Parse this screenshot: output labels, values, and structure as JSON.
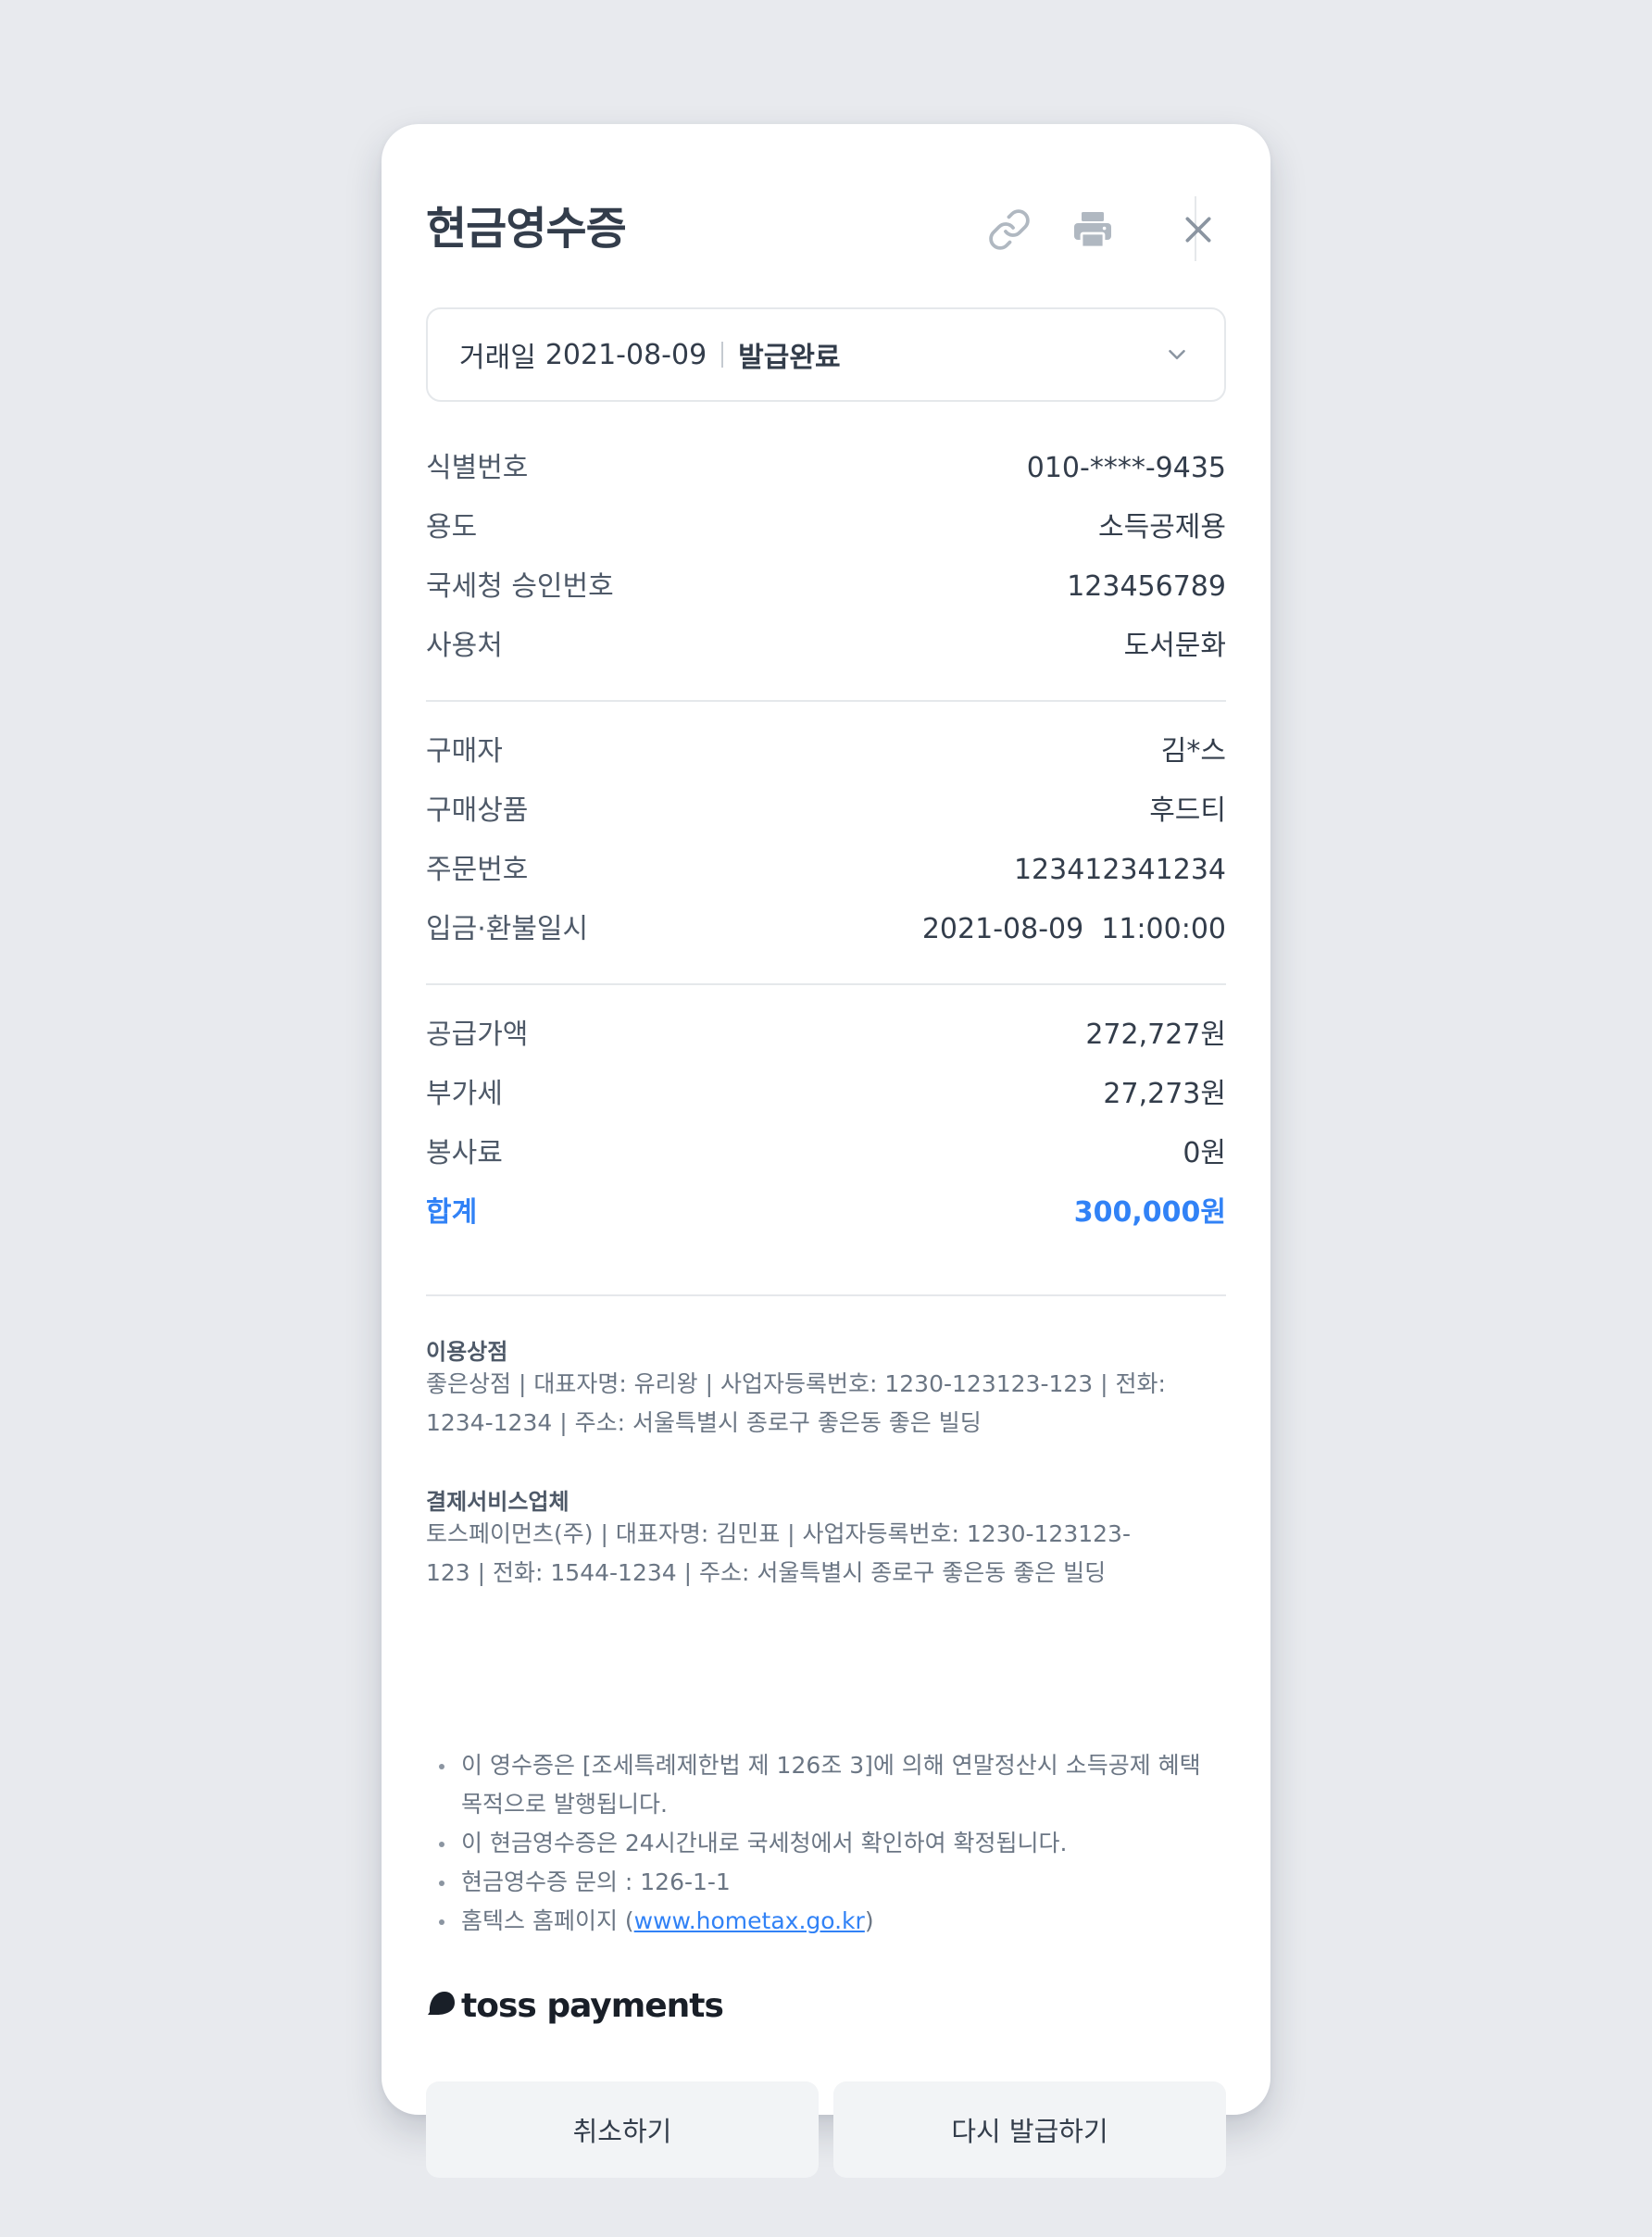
{
  "header": {
    "title": "현금영수증"
  },
  "select": {
    "date_label": "거래일",
    "date_value": "2021-08-09",
    "status": "발급완료"
  },
  "section1": [
    {
      "label": "식별번호",
      "value": "010-****-9435"
    },
    {
      "label": "용도",
      "value": "소득공제용"
    },
    {
      "label": "국세청 승인번호",
      "value": "123456789"
    },
    {
      "label": "사용처",
      "value": "도서문화"
    }
  ],
  "section2": [
    {
      "label": "구매자",
      "value": "김*스"
    },
    {
      "label": "구매상품",
      "value": "후드티"
    },
    {
      "label": "주문번호",
      "value": "123412341234"
    },
    {
      "label": "입금·환불일시",
      "value": "2021-08-09  11:00:00"
    }
  ],
  "section3": [
    {
      "label": "공급가액",
      "value": "272,727원"
    },
    {
      "label": "부가세",
      "value": "27,273원"
    },
    {
      "label": "봉사료",
      "value": "0원"
    }
  ],
  "total": {
    "label": "합계",
    "value": "300,000원"
  },
  "merchant": {
    "title": "이용상점",
    "body": "좋은상점 | 대표자명: 유리왕 | 사업자등록번호: 1230-123123-123 | 전화: 1234-1234 | 주소: 서울특별시 종로구 좋은동 좋은 빌딩"
  },
  "payment_company": {
    "title": "결제서비스업체",
    "body": "토스페이먼츠(주) | 대표자명: 김민표 | 사업자등록번호: 1230-123123-123 | 전화: 1544-1234 | 주소: 서울특별시 종로구 좋은동 좋은 빌딩"
  },
  "notes": {
    "n1": "이 영수증은 [조세특례제한법 제 126조 3]에 의해 연말정산시 소득공제 혜택 목적으로 발행됩니다.",
    "n2": "이 현금영수증은 24시간내로 국세청에서 확인하여 확정됩니다.",
    "n3": "현금영수증 문의 : 126-1-1",
    "n4_prefix": "홈텍스 홈페이지 (",
    "n4_link": "www.hometax.go.kr",
    "n4_suffix": ")"
  },
  "logo": {
    "text": "toss payments"
  },
  "buttons": {
    "cancel": "취소하기",
    "reissue": "다시 발급하기"
  },
  "icons": {
    "link": "link-icon",
    "print": "print-icon",
    "close": "close-icon",
    "chevron": "chevron-down-icon"
  },
  "colors": {
    "accent": "#3182f6",
    "background": "#e8eaee",
    "button_bg": "#f2f4f6"
  }
}
